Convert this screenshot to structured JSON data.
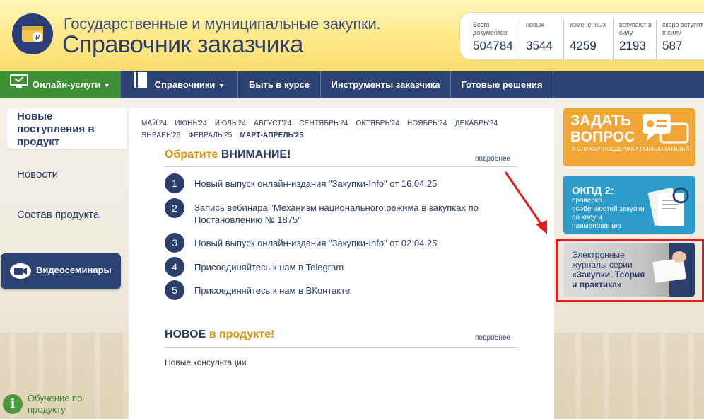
{
  "header": {
    "title_top": "Государственные и муниципальные закупки.",
    "title_main": "Справочник заказчика"
  },
  "stats": [
    {
      "label": "Всего документов",
      "value": "504784"
    },
    {
      "label": "новых",
      "value": "3544"
    },
    {
      "label": "измененных",
      "value": "4259"
    },
    {
      "label": "вступают в силу",
      "value": "2193"
    },
    {
      "label": "скоро вступят в силу",
      "value": "587"
    }
  ],
  "nav": {
    "online": "Онлайн-услуги",
    "references": "Справочники",
    "news": "Быть в курсе",
    "tools": "Инструменты заказчика",
    "solutions": "Готовые решения"
  },
  "sidebar": {
    "active_tab": "Новые поступления в продукт",
    "links": [
      "Новости",
      "Состав продукта"
    ],
    "webinar": "Видеосеминары",
    "training": "Обучение по продукту"
  },
  "months": [
    "МАЙ'24",
    "ИЮНЬ'24",
    "ИЮЛЬ'24",
    "АВГУСТ'24",
    "СЕНТЯБРЬ'24",
    "ОКТЯБРЬ'24",
    "НОЯБРЬ'24",
    "ДЕКАБРЬ'24",
    "ЯНВАРЬ'25",
    "ФЕВРАЛЬ'25",
    "МАРТ-АПРЕЛЬ'25"
  ],
  "attention": {
    "title_a": "Обратите ",
    "title_b": "ВНИМАНИЕ!",
    "more": "подробнее",
    "items": [
      {
        "num": "1",
        "text": "Новый выпуск онлайн-издания \"Закупки-Info\" от 16.04.25"
      },
      {
        "num": "2",
        "text": "Запись вебинара \"Механизм национального режима в закупках по Постановлению № 1875\""
      },
      {
        "num": "3",
        "text": "Новый выпуск онлайн-издания \"Закупки-Info\" от 02.04.25"
      },
      {
        "num": "4",
        "text": "Присоединяйтесь к нам в Telegram"
      },
      {
        "num": "5",
        "text": "Присоединяйтесь к нам в ВКонтакте"
      }
    ]
  },
  "new_section": {
    "title_a": "НОВОЕ ",
    "title_b": "в продукте!",
    "more": "подробнее",
    "item": "Новые консультации"
  },
  "banners": {
    "ask_big": "ЗАДАТЬ ВОПРОС",
    "ask_small": "В СЛУЖБУ ПОДДЕРЖКИ ПОЛЬЗОВАТЕЛЕЙ",
    "okpd_big": "ОКПД 2:",
    "okpd_small": "проверка особенностей закупки по коду и наименованию",
    "journal_a": "Электронные журналы серии",
    "journal_b": "«Закупки. Теория и практика»"
  },
  "colors": {
    "nav": "#2c4273",
    "online_green": "#3e8e34",
    "accent_orange": "#d4930e",
    "highlight_red": "#e31d1d"
  }
}
